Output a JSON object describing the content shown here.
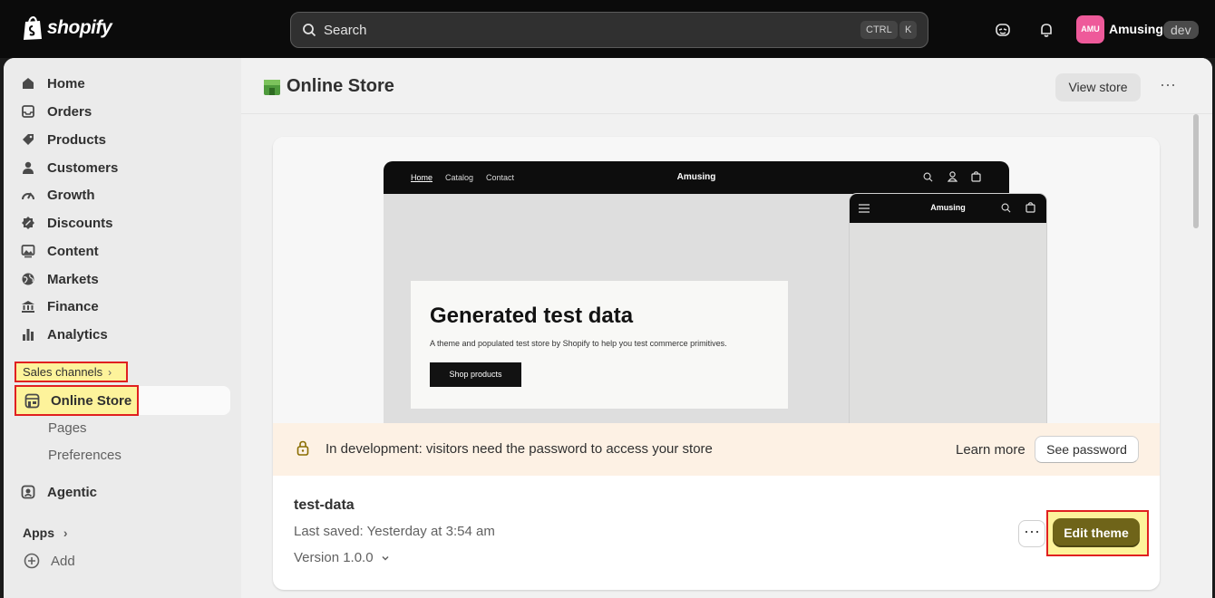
{
  "topbar": {
    "logo": "shopify",
    "search_placeholder": "Search",
    "shortcut_ctrl": "CTRL",
    "shortcut_k": "K",
    "avatar_initials": "AMU",
    "store_name": "Amusing",
    "badge": "dev"
  },
  "sidebar": {
    "items": [
      {
        "label": "Home",
        "icon": "home-icon"
      },
      {
        "label": "Orders",
        "icon": "inbox-icon"
      },
      {
        "label": "Products",
        "icon": "tag-icon"
      },
      {
        "label": "Customers",
        "icon": "person-icon"
      },
      {
        "label": "Growth",
        "icon": "gauge-icon"
      },
      {
        "label": "Discounts",
        "icon": "discount-icon"
      },
      {
        "label": "Content",
        "icon": "image-icon"
      },
      {
        "label": "Markets",
        "icon": "globe-icon"
      },
      {
        "label": "Finance",
        "icon": "bank-icon"
      },
      {
        "label": "Analytics",
        "icon": "bar-chart-icon"
      }
    ],
    "sales_channels_label": "Sales channels",
    "online_store_label": "Online Store",
    "sub_items": [
      "Pages",
      "Preferences"
    ],
    "agentic_label": "Agentic",
    "apps_label": "Apps",
    "add_label": "Add"
  },
  "header": {
    "title": "Online Store",
    "view_store": "View store"
  },
  "preview": {
    "desktop_nav": [
      "Home",
      "Catalog",
      "Contact"
    ],
    "store_name": "Amusing",
    "hero_title": "Generated test data",
    "hero_subtitle": "A theme and populated test store by Shopify to help you test commerce primitives.",
    "hero_button": "Shop products"
  },
  "banner": {
    "message": "In development: visitors need the password to access your store",
    "learn_more": "Learn more",
    "see_password": "See password"
  },
  "theme": {
    "name": "test-data",
    "last_saved": "Last saved: Yesterday at 3:54 am",
    "version": "Version 1.0.0",
    "edit_button": "Edit theme"
  },
  "colors": {
    "topbar": "#0b0b0b",
    "highlight": "#fdf39b",
    "highlight_border": "#e02020",
    "edit_button": "#6f6419",
    "banner": "#fdf1e4"
  }
}
